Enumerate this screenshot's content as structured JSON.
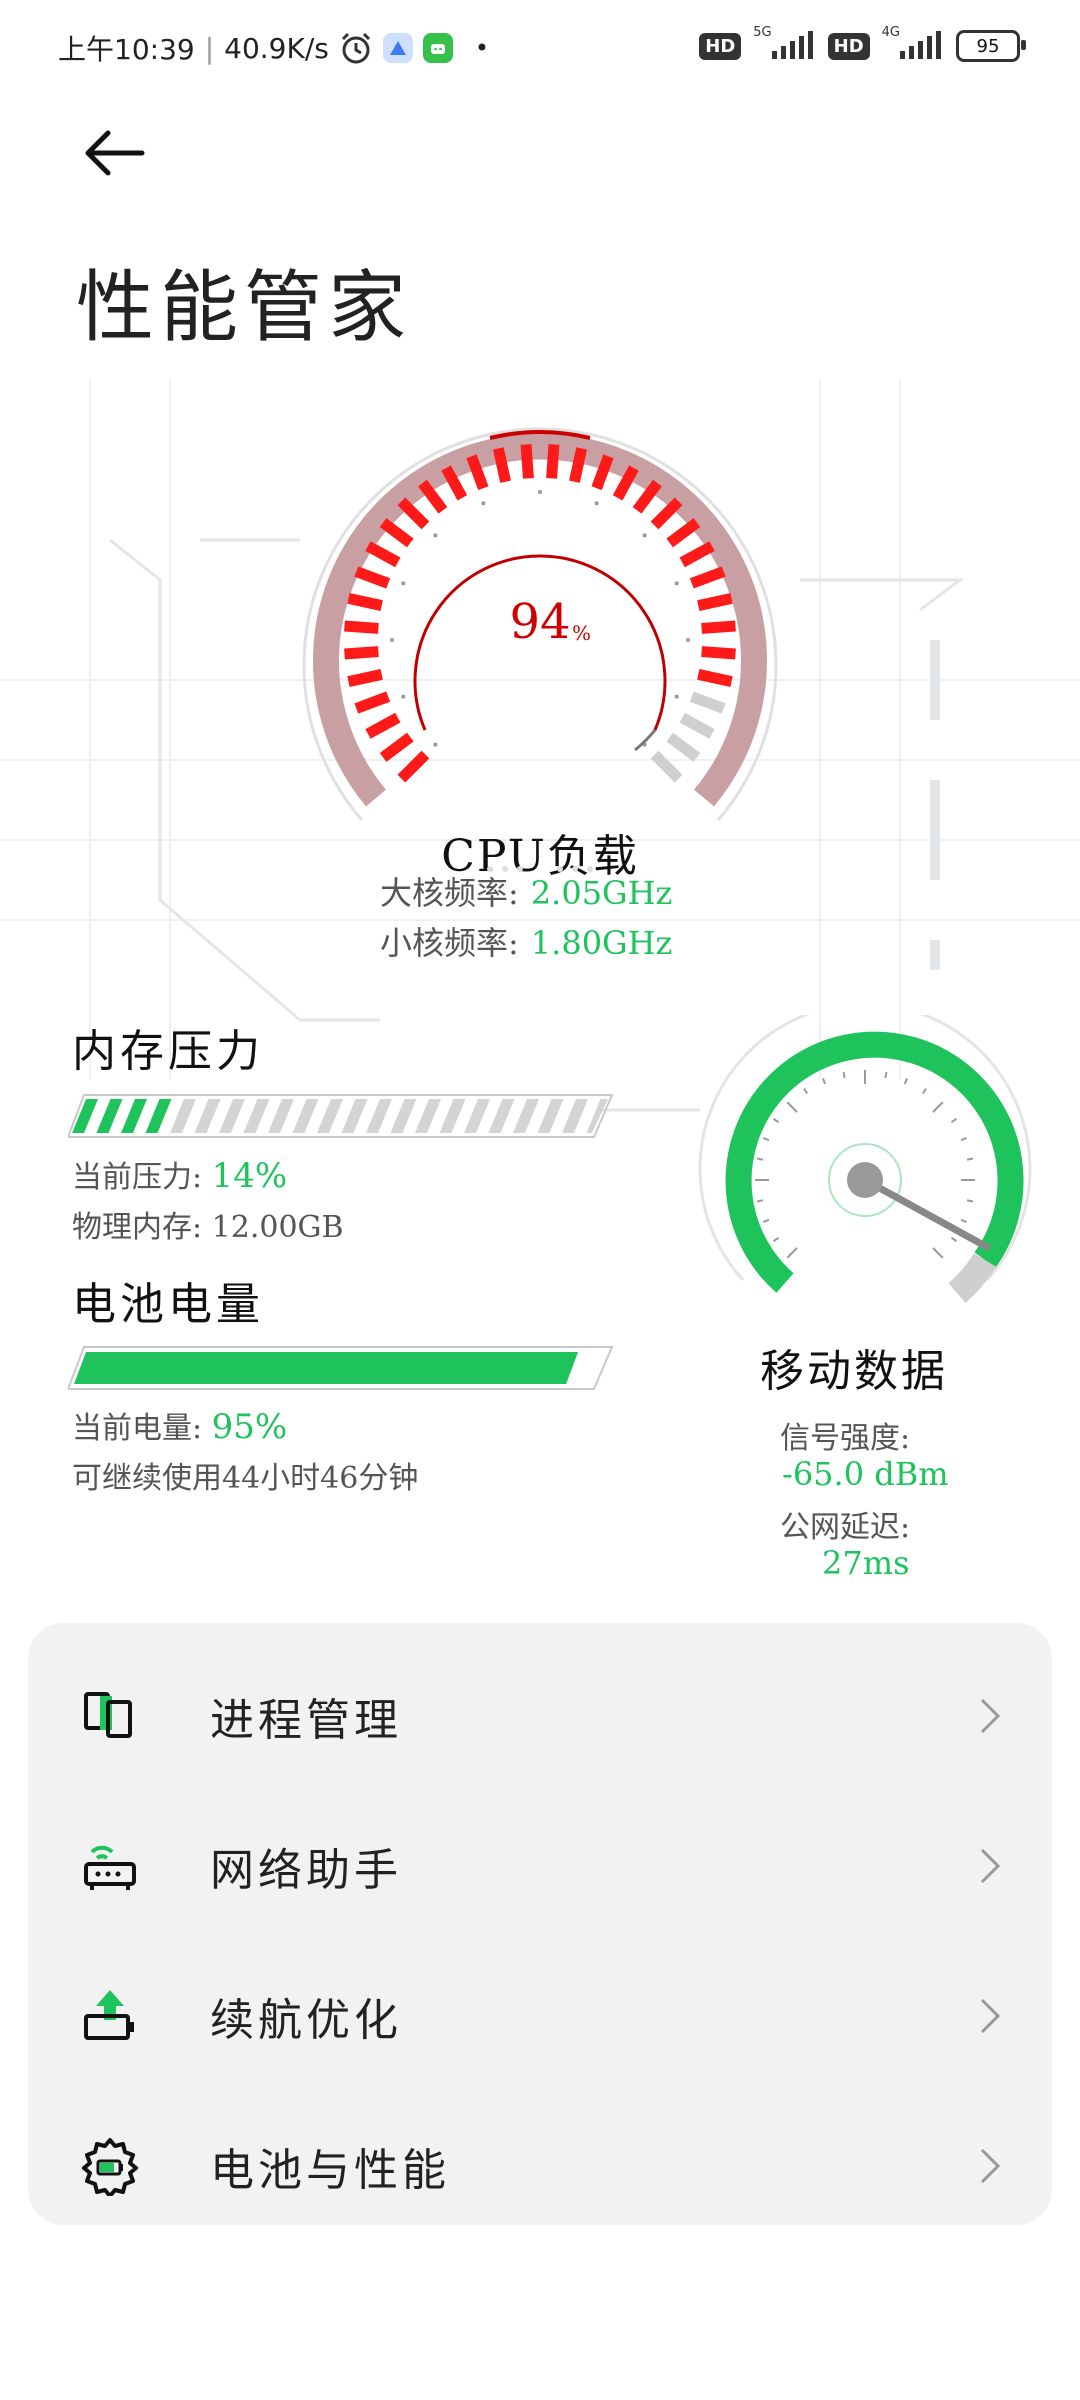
{
  "status_bar": {
    "time": "上午10:39",
    "speed": "40.9K/s",
    "net1": "5G",
    "net2": "4G",
    "hd": "HD",
    "battery": "95"
  },
  "header": {
    "title": "性能管家"
  },
  "cpu": {
    "load_value": "94",
    "load_unit": "%",
    "label": "CPU负载",
    "big_core_label": "大核频率:",
    "big_core_value": "2.05GHz",
    "little_core_label": "小核频率:",
    "little_core_value": "1.80GHz"
  },
  "memory": {
    "title": "内存压力",
    "pressure_label": "当前压力:",
    "pressure_value": "14%",
    "pressure_fraction": 0.14,
    "physical_label": "物理内存:",
    "physical_value": "12.00GB"
  },
  "battery": {
    "title": "电池电量",
    "level_label": "当前电量:",
    "level_value": "95%",
    "level_fraction": 0.95,
    "remaining": "可继续使用44小时46分钟"
  },
  "mobile_data": {
    "title": "移动数据",
    "signal_label": "信号强度:",
    "signal_value": "-65.0 dBm",
    "latency_label": "公网延迟:",
    "latency_value": "27ms"
  },
  "menu": {
    "items": [
      {
        "label": "进程管理",
        "icon": "process-icon"
      },
      {
        "label": "网络助手",
        "icon": "router-icon"
      },
      {
        "label": "续航优化",
        "icon": "battery-boost-icon"
      },
      {
        "label": "电池与性能",
        "icon": "gear-battery-icon"
      }
    ]
  },
  "colors": {
    "green": "#1ec35c",
    "red": "#e00000"
  }
}
